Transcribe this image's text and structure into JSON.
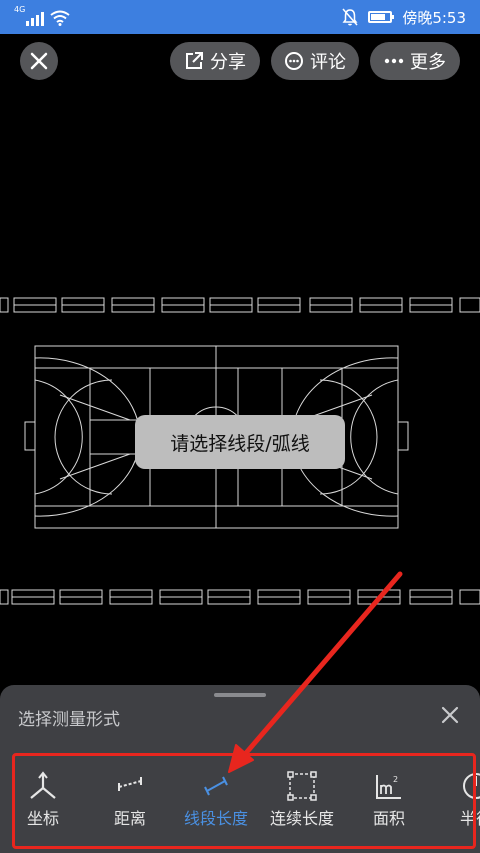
{
  "status_bar": {
    "network": "4G",
    "time": "傍晚5:53"
  },
  "toolbar": {
    "share_label": "分享",
    "comment_label": "评论",
    "more_label": "更多"
  },
  "toast": {
    "text": "请选择线段/弧线"
  },
  "panel": {
    "title": "选择测量形式",
    "tools": [
      {
        "label": "坐标",
        "icon": "coordinate-icon",
        "active": false
      },
      {
        "label": "距离",
        "icon": "distance-icon",
        "active": false
      },
      {
        "label": "线段长度",
        "icon": "segment-length-icon",
        "active": true
      },
      {
        "label": "连续长度",
        "icon": "continuous-length-icon",
        "active": false
      },
      {
        "label": "面积",
        "icon": "area-icon",
        "active": false
      },
      {
        "label": "半径",
        "icon": "radius-icon",
        "active": false
      }
    ]
  },
  "colors": {
    "status_bar": "#3D7FE0",
    "button_bg": "#555659",
    "panel_bg": "#3F4044",
    "active": "#4A90E2",
    "annotation": "#E8261E"
  }
}
